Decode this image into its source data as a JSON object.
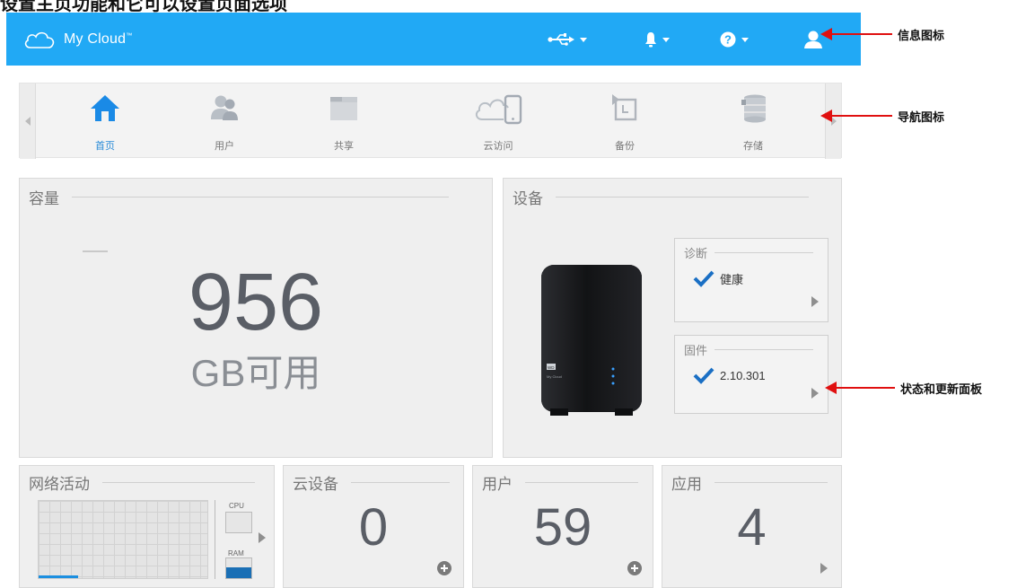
{
  "caption": "设置主页功能和它可以设置页面选项",
  "appbar": {
    "brand": "My Cloud",
    "brand_mark": "™",
    "icons": [
      "usb-icon",
      "bell-icon",
      "help-icon",
      "user-icon"
    ],
    "color": "#21a9f5"
  },
  "nav": {
    "items": [
      {
        "label": "首页",
        "icon": "home-icon",
        "active": true
      },
      {
        "label": "用户",
        "icon": "users-icon",
        "active": false
      },
      {
        "label": "共享",
        "icon": "folder-icon",
        "active": false
      },
      {
        "label": "云访问",
        "icon": "cloud-phone-icon",
        "active": false
      },
      {
        "label": "备份",
        "icon": "backup-icon",
        "active": false
      },
      {
        "label": "存储",
        "icon": "storage-icon",
        "active": false
      }
    ],
    "active_color": "#2a8bd8"
  },
  "capacity": {
    "title": "容量",
    "value": "956",
    "unit": "GB可用"
  },
  "device": {
    "title": "设备",
    "diagnostics": {
      "title": "诊断",
      "status": "健康"
    },
    "firmware": {
      "title": "固件",
      "version": "2.10.301"
    },
    "device_brand": "WD",
    "device_name": "My Cloud"
  },
  "network": {
    "title": "网络活动",
    "cpu_label": "CPU",
    "ram_label": "RAM",
    "cpu_level": 0.0,
    "ram_level": 0.55
  },
  "cloud_devices": {
    "title": "云设备",
    "value": "0"
  },
  "users": {
    "title": "用户",
    "value": "59"
  },
  "apps": {
    "title": "应用",
    "value": "4"
  },
  "annotations": {
    "info_icon": "信息图标",
    "nav_icons": "导航图标",
    "status_panel": "状态和更新面板"
  },
  "accent_red": "#e01010"
}
